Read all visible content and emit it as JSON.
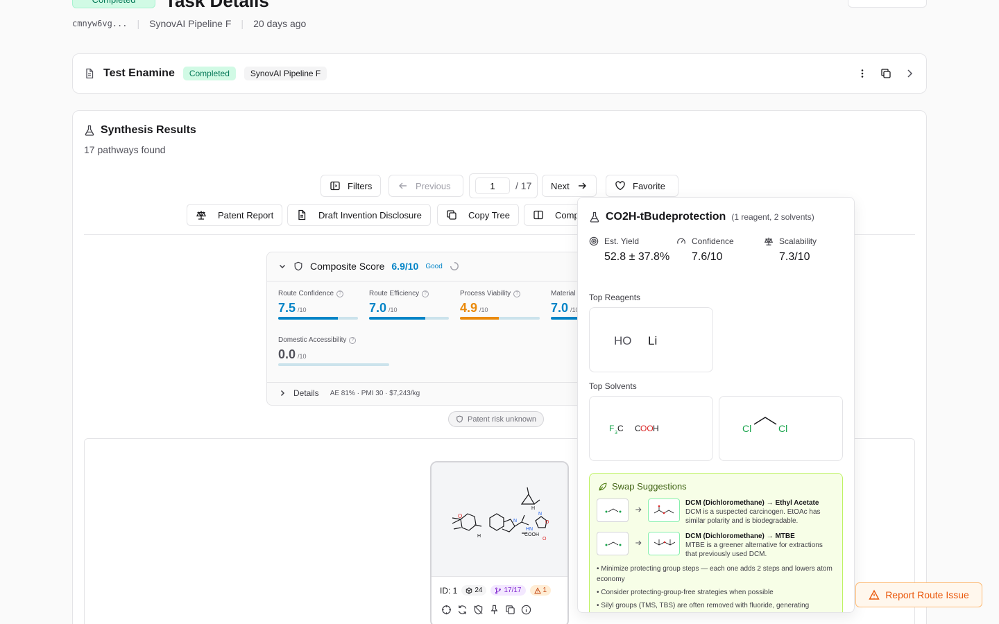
{
  "header": {
    "status": "Completed",
    "title": "Task Details",
    "task_id": "cmnyw6vg...",
    "pipeline": "SynovAI Pipeline F",
    "age": "20 days ago"
  },
  "task": {
    "name": "Test Enamine",
    "status": "Completed",
    "pipeline": "SynovAI Pipeline F"
  },
  "results": {
    "title": "Synthesis Results",
    "subtitle": "17 pathways found",
    "toolbar": {
      "filters": "Filters",
      "previous": "Previous",
      "page": "1",
      "total": "/ 17",
      "next": "Next",
      "favorite": "Favorite",
      "patent_report": "Patent Report",
      "draft_disclosure": "Draft Invention Disclosure",
      "copy_tree": "Copy Tree",
      "compare": "Comp"
    }
  },
  "composite": {
    "label": "Composite Score",
    "value": "6.9/10",
    "rating": "Good",
    "metrics": [
      {
        "label": "Route Confidence",
        "value": "7.5",
        "unit": "/10",
        "fraction": 0.75,
        "color": "#0284c7"
      },
      {
        "label": "Route Efficiency",
        "value": "7.0",
        "unit": "/10",
        "fraction": 0.7,
        "color": "#0284c7"
      },
      {
        "label": "Process Viability",
        "value": "4.9",
        "unit": "/10",
        "fraction": 0.49,
        "color": "#ea8a0c"
      },
      {
        "label": "Material",
        "value": "7.0",
        "unit": "/10",
        "fraction": 0.7,
        "color": "#0284c7"
      },
      {
        "label": "Domestic Accessibility",
        "value": "0.0",
        "unit": "/10",
        "fraction": 0.0,
        "color": "#0284c7"
      }
    ],
    "details_label": "Details",
    "details_summary": "AE 81% · PMI 30 · $7,243/kg"
  },
  "patent_badge": "Patent risk unknown",
  "node": {
    "id": "ID: 1",
    "atoms": "24",
    "routes": "17/17",
    "warnings": "1"
  },
  "popover": {
    "title": "CO2H-tBudeprotection",
    "subtitle": "(1 reagent, 2 solvents)",
    "yield_label": "Est. Yield",
    "yield_value": "52.8 ± 37.8%",
    "confidence_label": "Confidence",
    "confidence_value": "7.6/10",
    "scalability_label": "Scalability",
    "scalability_value": "7.3/10",
    "reagents_label": "Top Reagents",
    "solvents_label": "Top Solvents",
    "reagent_atoms": {
      "ho": "HO",
      "li": "Li"
    },
    "solvent1": {
      "f": "F",
      "sub3": "3",
      "c": "C",
      "cooh_c": "C",
      "cooh_oo": "OO",
      "cooh_h": "H"
    },
    "solvent2": {
      "cl1": "Cl",
      "cl2": "Cl"
    },
    "swap_title": "Swap Suggestions",
    "swaps": [
      {
        "title": "DCM (Dichloromethane) → Ethyl Acetate",
        "desc": "DCM is a suspected carcinogen. EtOAc has similar polarity and is biodegradable."
      },
      {
        "title": "DCM (Dichloromethane) → MTBE",
        "desc": "MTBE is a greener alternative for extractions that previously used DCM."
      }
    ],
    "tips": [
      "• Minimize protecting group steps — each one adds 2 steps and lowers atom economy",
      "• Consider protecting-group-free strategies when possible",
      "• Silyl groups (TMS, TBS) are often removed with fluoride, generating"
    ]
  },
  "report_button": "Report Route Issue",
  "colors": {
    "accent": "#0284c7",
    "success": "#047857",
    "warning": "#ea580c",
    "swap_bg": "#f7fee7"
  }
}
